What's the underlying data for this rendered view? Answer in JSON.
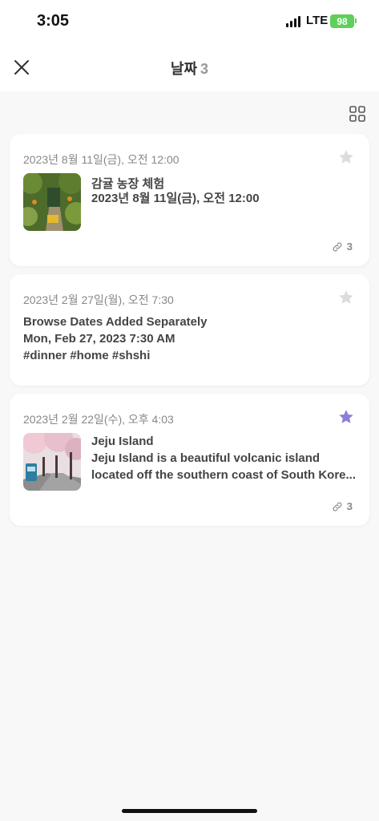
{
  "status": {
    "time": "3:05",
    "network": "LTE",
    "battery": "98"
  },
  "header": {
    "title": "날짜",
    "count": "3"
  },
  "cards": [
    {
      "date": "2023년 8월 11일(금), 오전 12:00",
      "title": "감귤 농장 체험",
      "body": "2023년 8월 11일(금), 오전 12:00",
      "links": "3",
      "starred": false
    },
    {
      "date": "2023년 2월 27일(월), 오전 7:30",
      "title": "Browse Dates Added Separately",
      "line2": "Mon, Feb 27, 2023 7:30 AM",
      "line3": "#dinner #home #shshi",
      "starred": false
    },
    {
      "date": "2023년 2월 22일(수), 오후 4:03",
      "title": "Jeju Island",
      "body1": "Jeju Island is a beautiful volcanic island",
      "body2": "located off the southern coast of South Kore...",
      "links": "3",
      "starred": true
    }
  ],
  "colors": {
    "star_active": "#8b7fd8",
    "star_inactive": "#dcdcdc",
    "battery": "#5fcf5a"
  }
}
